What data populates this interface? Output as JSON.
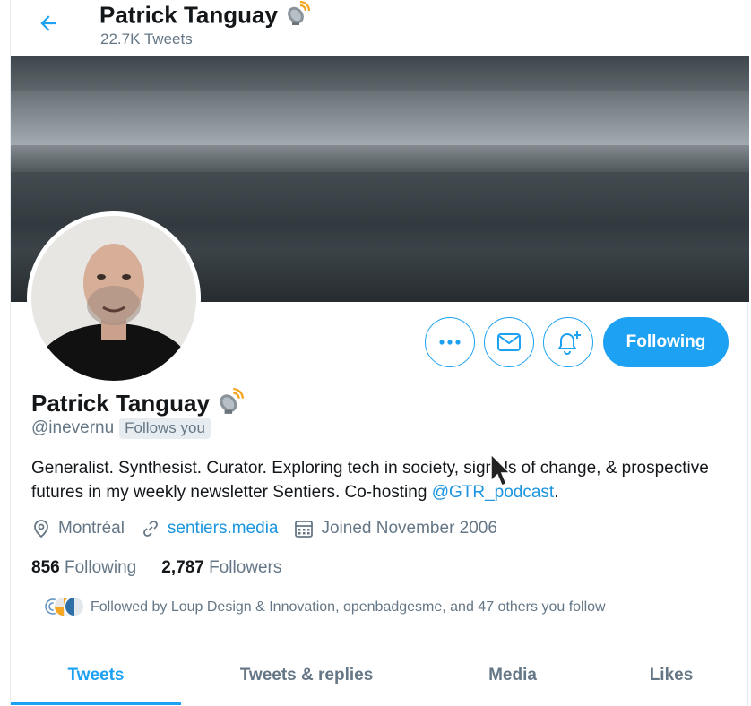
{
  "header": {
    "title": "Patrick Tanguay",
    "tweet_count": "22.7K Tweets"
  },
  "profile": {
    "name": "Patrick Tanguay",
    "handle": "@inevernu",
    "follows_you": "Follows you",
    "bio_text": "Generalist. Synthesist. Curator. Exploring tech in society, signals of change, & prospective futures in my weekly newsletter Sentiers. Co-hosting ",
    "bio_mention": "@GTR_podcast",
    "bio_end": ".",
    "location": "Montréal",
    "website": "sentiers.media",
    "joined": "Joined November 2006"
  },
  "stats": {
    "following_count": "856",
    "following_label": "Following",
    "followers_count": "2,787",
    "followers_label": "Followers"
  },
  "followed_by": "Followed by Loup Design & Innovation, openbadgesme, and 47 others you follow",
  "actions": {
    "following_label": "Following"
  },
  "tabs": [
    {
      "label": "Tweets",
      "active": true
    },
    {
      "label": "Tweets & replies",
      "active": false
    },
    {
      "label": "Media",
      "active": false
    },
    {
      "label": "Likes",
      "active": false
    }
  ],
  "colors": {
    "accent": "#1da1f2",
    "link": "#1b95e0",
    "muted": "#657786"
  },
  "icons": {
    "name_badge": "satellite-dish-icon"
  }
}
